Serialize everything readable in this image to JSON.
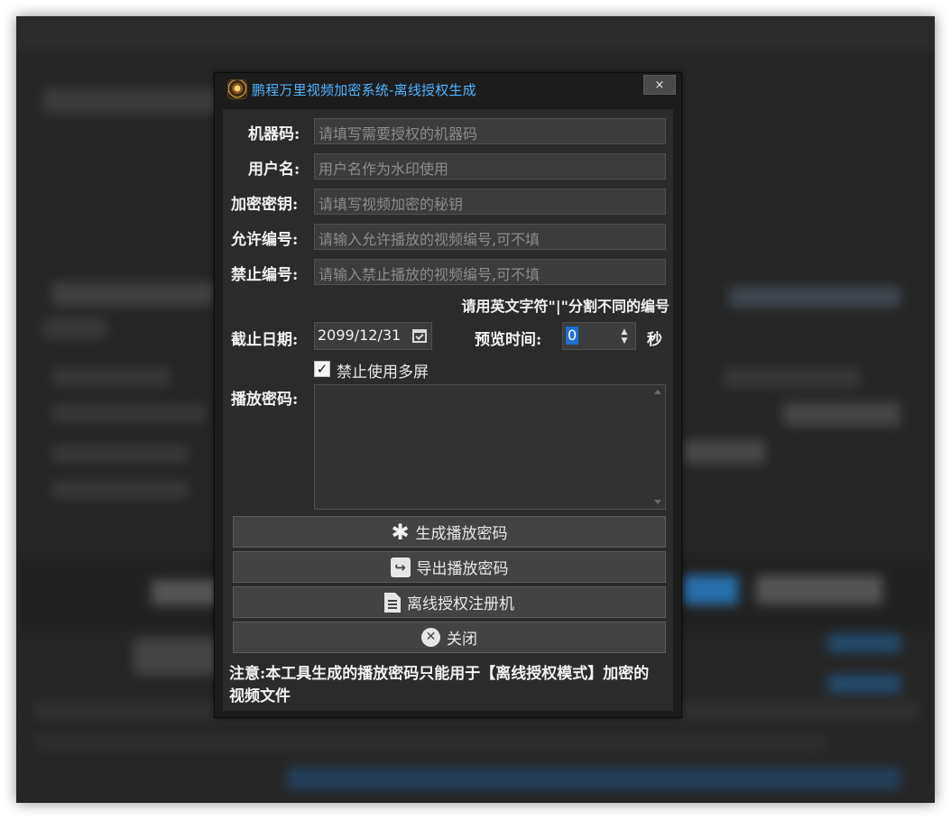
{
  "dialog": {
    "title": "鹏程万里视频加密系统-离线授权生成",
    "close_symbol": "×"
  },
  "form": {
    "machine_code": {
      "label": "机器码:",
      "placeholder": "请填写需要授权的机器码"
    },
    "username": {
      "label": "用户名:",
      "placeholder": "用户名作为水印使用"
    },
    "encrypt_key": {
      "label": "加密密钥:",
      "placeholder": "请填写视频加密的秘钥"
    },
    "allow_ids": {
      "label": "允许编号:",
      "placeholder": "请输入允许播放的视频编号,可不填"
    },
    "forbid_ids": {
      "label": "禁止编号:",
      "placeholder": "请输入禁止播放的视频编号,可不填"
    },
    "separator_hint": "请用英文字符\"|\"分割不同的编号",
    "expiry": {
      "label": "截止日期:",
      "value": "2099/12/31"
    },
    "preview": {
      "label": "预览时间:",
      "value": "0",
      "unit": "秒"
    },
    "multiscreen": {
      "label": "禁止使用多屏",
      "checked": true,
      "check_mark": "✓"
    },
    "play_password": {
      "label": "播放密码:",
      "value": ""
    }
  },
  "buttons": {
    "generate": "生成播放密码",
    "export": "导出播放密码",
    "register": "离线授权注册机",
    "close": "关闭"
  },
  "icons": {
    "generate": "✱",
    "export": "↪",
    "close": "✕",
    "spin_up": "▲",
    "spin_down": "▼"
  },
  "note": "注意:本工具生成的播放密码只能用于【离线授权模式】加密的视频文件",
  "colors": {
    "title_text": "#4fb3ff",
    "dialog_bg": "#1c1c1c",
    "panel_bg": "#2b2b2b",
    "selection": "#1f6fd1"
  }
}
